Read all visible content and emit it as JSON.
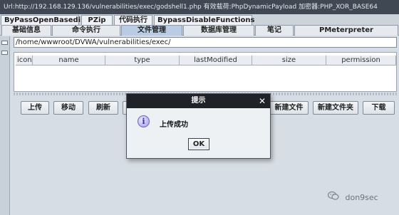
{
  "window": {
    "title": "Url:http://192.168.129.136/vulnerabilities/exec/godshell1.php 有效载荷:PhpDynamicPayload 加密器:PHP_XOR_BASE64"
  },
  "plugin_tabs": [
    {
      "label": "ByPassOpenBasedir"
    },
    {
      "label": "PZip"
    },
    {
      "label": "代码执行"
    },
    {
      "label": "BypassDisableFunctions"
    }
  ],
  "main_tabs": [
    {
      "label": "基础信息"
    },
    {
      "label": "命令执行"
    },
    {
      "label": "文件管理",
      "active": true
    },
    {
      "label": "数据库管理"
    },
    {
      "label": "笔记"
    },
    {
      "label": "PMeterpreter"
    }
  ],
  "file_manager": {
    "path": "/home/wwwroot/DVWA/vulnerabilities/exec/",
    "columns": [
      "icon",
      "name",
      "type",
      "lastModified",
      "size",
      "permission"
    ],
    "buttons": {
      "upload": "上传",
      "move": "移动",
      "refresh": "刷新",
      "new_file": "新建文件",
      "new_folder": "新建文件夹",
      "download": "下载"
    }
  },
  "dialog": {
    "title": "提示",
    "close_glyph": "✕",
    "icon_glyph": "i",
    "message": "上传成功",
    "ok": "OK"
  },
  "watermark": {
    "text": "don9sec"
  },
  "colors": {
    "titlebar": "#404854",
    "active_tab": "#b8cde4",
    "dialog_titlebar": "#1f2228",
    "info_icon": "#a59bea"
  }
}
